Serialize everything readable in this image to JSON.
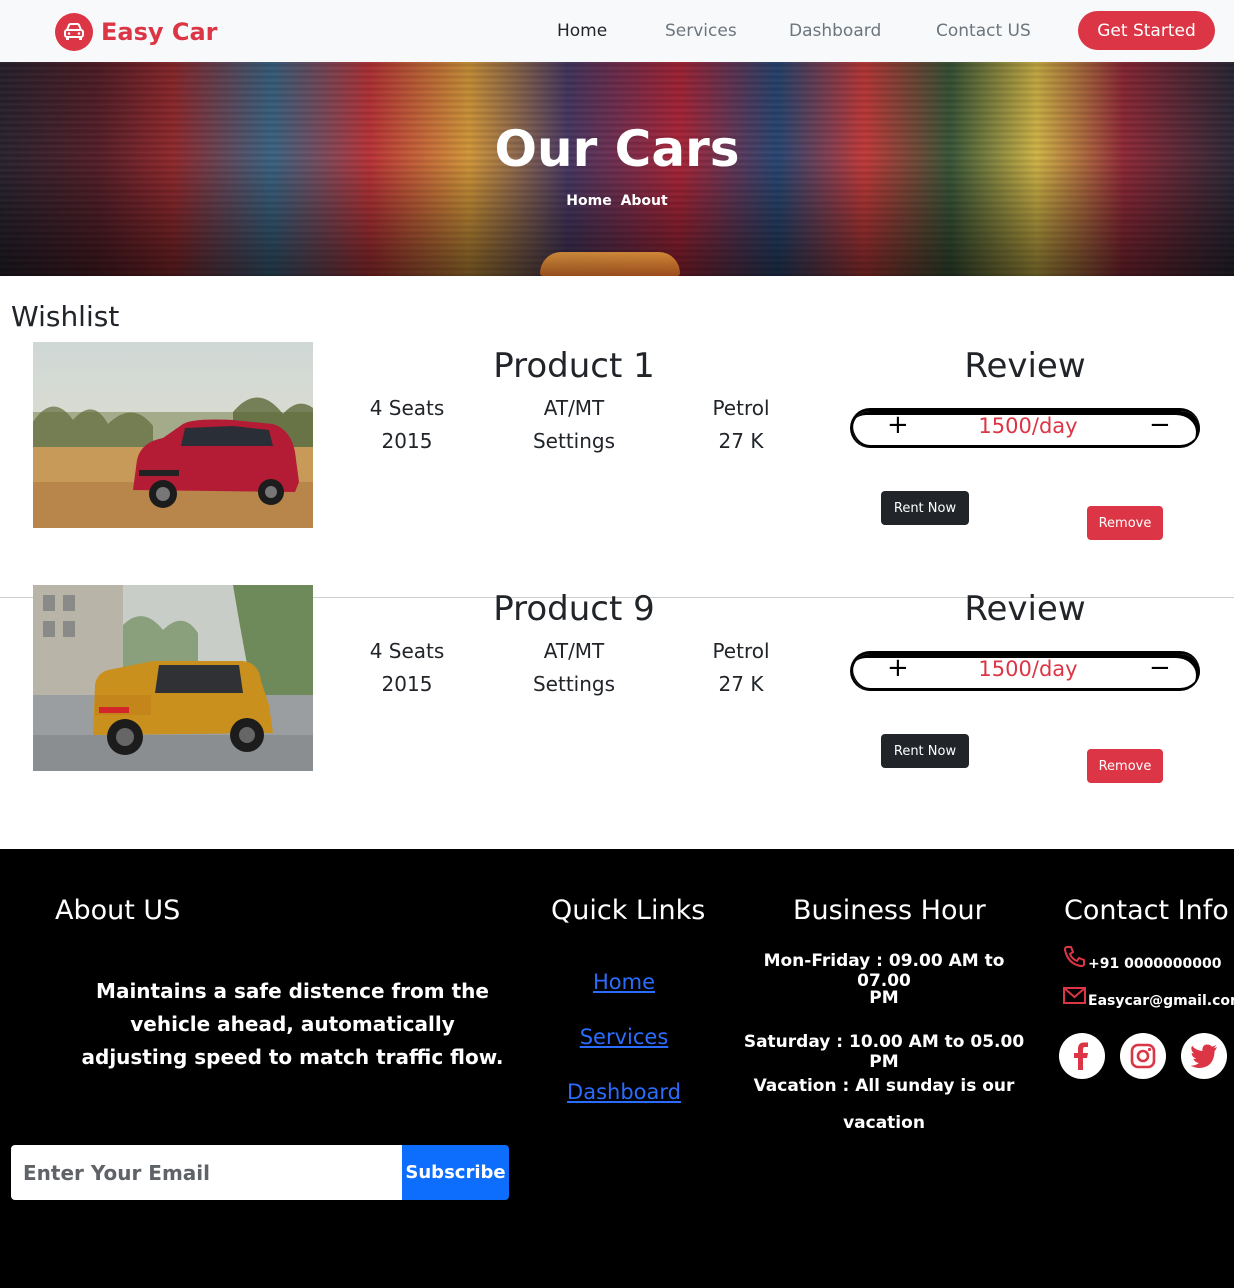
{
  "brand": {
    "name": "Easy Car",
    "icon": "car-icon"
  },
  "nav": {
    "links": [
      "Home",
      "Services",
      "Dashboard",
      "Contact US"
    ],
    "active": "Home",
    "cta": "Get Started"
  },
  "hero": {
    "title": "Our Cars",
    "breadcrumbs": [
      "Home",
      "About"
    ]
  },
  "wishlist": {
    "title": "Wishlist",
    "items": [
      {
        "name": "Product 1",
        "seats": "4 Seats",
        "year": "2015",
        "transmission": "AT/MT",
        "settings": "Settings",
        "fuel": "Petrol",
        "mileage": "27 K",
        "review_label": "Review",
        "plus": "+",
        "price": "1500/day",
        "minus": "−",
        "rent_label": "Rent Now",
        "remove_label": "Remove"
      },
      {
        "name": "Product 9",
        "seats": "4 Seats",
        "year": "2015",
        "transmission": "AT/MT",
        "settings": "Settings",
        "fuel": "Petrol",
        "mileage": "27 K",
        "review_label": "Review",
        "plus": "+",
        "price": "1500/day",
        "minus": "−",
        "rent_label": "Rent Now",
        "remove_label": "Remove"
      }
    ]
  },
  "footer": {
    "about": {
      "title": "About US",
      "text": "Maintains a safe distence from the vehicle ahead, automatically adjusting speed to match traffic flow.",
      "email_placeholder": "Enter Your Email",
      "subscribe_label": "Subscribe"
    },
    "quick_links": {
      "title": "Quick Links",
      "links": [
        "Home",
        "Services",
        "Dashboard"
      ]
    },
    "business_hour": {
      "title": "Business Hour",
      "lines": [
        "Mon-Friday : 09.00 AM to 07.00",
        "PM",
        "Saturday : 10.00 AM to 05.00 PM",
        "Vacation : All sunday is our",
        "vacation"
      ]
    },
    "contact": {
      "title": "Contact Info",
      "phone": "+91 0000000000",
      "email": "Easycar@gmail.com",
      "phone_icon": "phone-icon",
      "email_icon": "mail-icon",
      "socials": [
        "facebook-icon",
        "instagram-icon",
        "twitter-icon"
      ]
    }
  },
  "colors": {
    "brand_red": "#dc3545",
    "dark": "#212529",
    "link_blue": "#2b6cff",
    "subscribe_blue": "#0d6efd"
  }
}
